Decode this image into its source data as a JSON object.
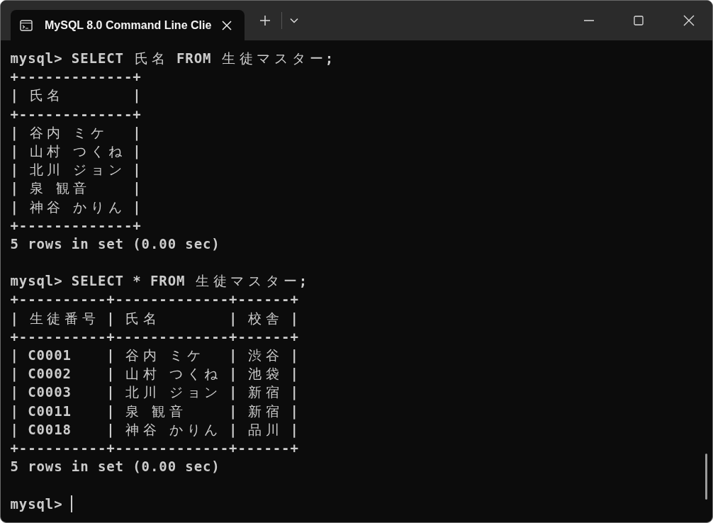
{
  "tab": {
    "title": "MySQL 8.0 Command Line Clie"
  },
  "blocks": [
    {
      "command": "mysql> SELECT 氏名 FROM 生徒マスター;",
      "output": [
        "+-------------+",
        "| 氏名        |",
        "+-------------+",
        "| 谷内 ミケ   |",
        "| 山村 つくね |",
        "| 北川 ジョン |",
        "| 泉 観音     |",
        "| 神谷 かりん |",
        "+-------------+"
      ],
      "status": "5 rows in set (0.00 sec)"
    },
    {
      "command": "mysql> SELECT * FROM 生徒マスター;",
      "output": [
        "+----------+-------------+------+",
        "| 生徒番号 | 氏名        | 校舎 |",
        "+----------+-------------+------+",
        "| C0001    | 谷内 ミケ   | 渋谷 |",
        "| C0002    | 山村 つくね | 池袋 |",
        "| C0003    | 北川 ジョン | 新宿 |",
        "| C0011    | 泉 観音     | 新宿 |",
        "| C0018    | 神谷 かりん | 品川 |",
        "+----------+-------------+------+"
      ],
      "status": "5 rows in set (0.00 sec)"
    }
  ],
  "prompt": "mysql>"
}
